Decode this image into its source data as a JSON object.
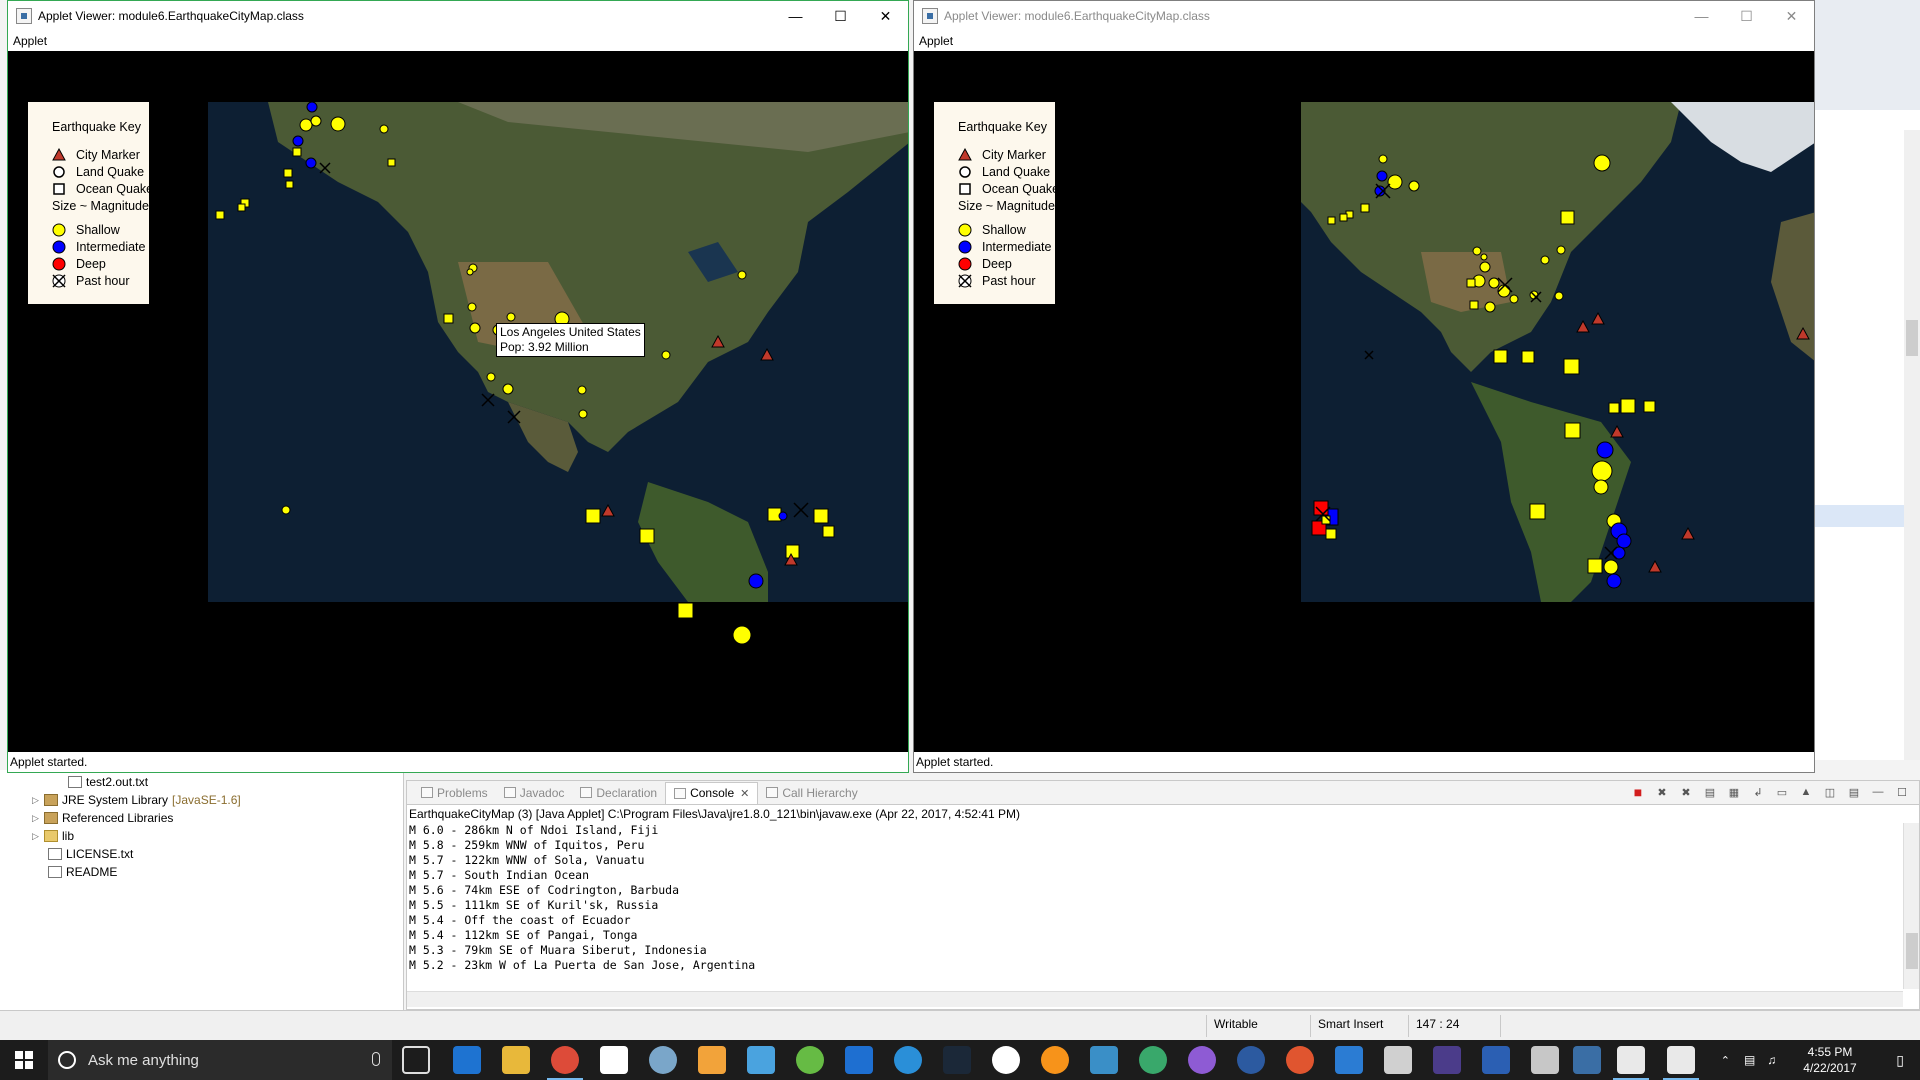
{
  "windows": [
    {
      "title": "Applet Viewer: module6.EarthquakeCityMap.class",
      "menu": "Applet",
      "status": "Applet started.",
      "key": {
        "title": "Earthquake Key",
        "city": "City Marker",
        "land": "Land Quake",
        "ocean": "Ocean Quake",
        "size": "Size ~ Magnitude",
        "shallow": "Shallow",
        "intermediate": "Intermediate",
        "deep": "Deep",
        "past_hour": "Past hour"
      },
      "tooltip": {
        "line1": "Los Angeles United States",
        "line2": "Pop: 3.92 Million"
      }
    },
    {
      "title": "Applet Viewer: module6.EarthquakeCityMap.class",
      "menu": "Applet",
      "status": "Applet started.",
      "key": {
        "title": "Earthquake Key",
        "city": "City Marker",
        "land": "Land Quake",
        "ocean": "Ocean Quake",
        "size": "Size ~ Magnitude",
        "shallow": "Shallow",
        "intermediate": "Intermediate",
        "deep": "Deep",
        "past_hour": "Past hour"
      }
    }
  ],
  "window_controls": {
    "minimize": "—",
    "maximize": "☐",
    "close": "✕"
  },
  "package_explorer": {
    "items": [
      {
        "label": "test2.out.txt",
        "extra": ""
      },
      {
        "label": "JRE System Library",
        "extra": "[JavaSE-1.6]"
      },
      {
        "label": "Referenced Libraries",
        "extra": ""
      },
      {
        "label": "lib",
        "extra": ""
      },
      {
        "label": "LICENSE.txt",
        "extra": ""
      },
      {
        "label": "README",
        "extra": ""
      }
    ]
  },
  "console": {
    "tabs": [
      "Problems",
      "Javadoc",
      "Declaration",
      "Console",
      "Call Hierarchy"
    ],
    "active_tab": "Console",
    "path": "EarthquakeCityMap (3) [Java Applet] C:\\Program Files\\Java\\jre1.8.0_121\\bin\\javaw.exe (Apr 22, 2017, 4:52:41 PM)",
    "lines": [
      "M 6.0 - 286km N of Ndoi Island, Fiji",
      "M 5.8 - 259km WNW of Iquitos, Peru",
      "M 5.7 - 122km WNW of Sola, Vanuatu",
      "M 5.7 - South Indian Ocean",
      "M 5.6 - 74km ESE of Codrington, Barbuda",
      "M 5.5 - 111km SE of Kuril'sk, Russia",
      "M 5.4 - Off the coast of Ecuador",
      "M 5.4 - 112km SE of Pangai, Tonga",
      "M 5.3 - 79km SE of Muara Siberut, Indonesia",
      "M 5.2 - 23km W of La Puerta de San Jose, Argentina"
    ]
  },
  "status_bar": {
    "mode": "Writable",
    "insert": "Smart Insert",
    "position": "147 : 24"
  },
  "taskbar": {
    "search_placeholder": "Ask me anything",
    "time": "4:55 PM",
    "date": "4/22/2017"
  },
  "colors": {
    "shallow": "#ffff00",
    "intermediate": "#0000ff",
    "deep": "#ff0000",
    "city": "#c0392b",
    "key_bg": "#fdf8ed",
    "active_window_border": "#34a853"
  }
}
